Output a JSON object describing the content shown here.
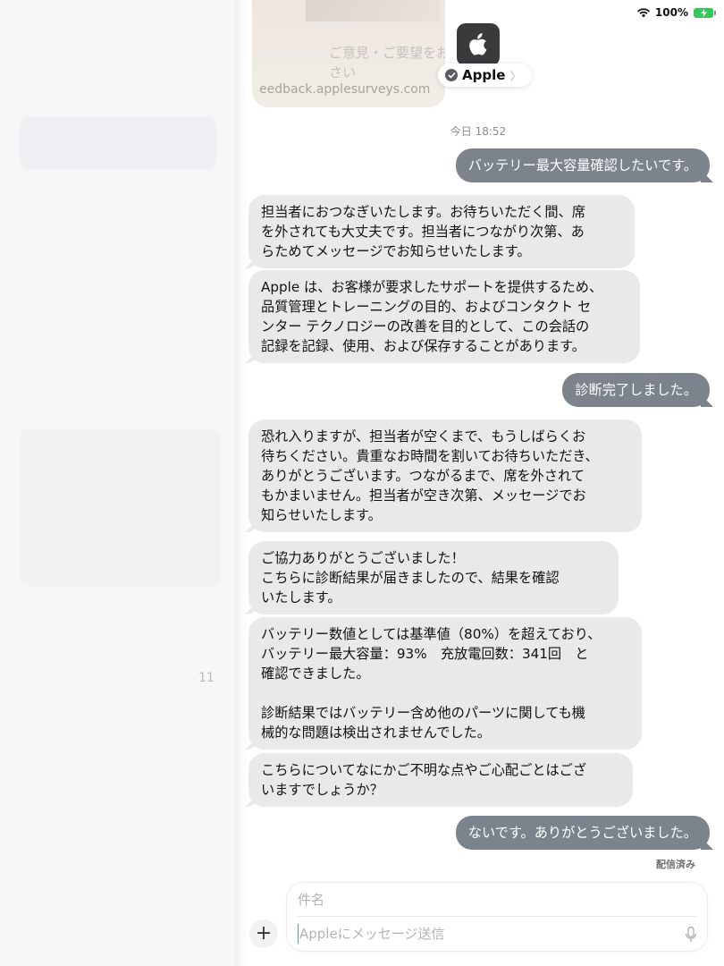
{
  "status_bar": {
    "battery_text": "100%"
  },
  "header": {
    "contact_name": "Apple",
    "preview": {
      "line1": "ご意見・ご要望をお",
      "line2": "さい",
      "url": "eedback.applesurveys.com"
    }
  },
  "sidebar": {
    "ghost_text_1": "11"
  },
  "thread": {
    "timestamp": "今日 18:52",
    "messages": [
      {
        "dir": "out",
        "text": "バッテリー最大容量確認したいです。"
      },
      {
        "dir": "in",
        "text": "担当者におつなぎいたします。お待ちいただく間、席\nを外されても大丈夫です。担当者につながり次第、あ\nらためてメッセージでお知らせいたします。"
      },
      {
        "dir": "in",
        "text": "Apple は、お客様が要求したサポートを提供するため、\n品質管理とトレーニングの目的、およびコンタクト セ\nンター テクノロジーの改善を目的として、この会話の\n記録を記録、使用、および保存することがあります。"
      },
      {
        "dir": "out",
        "text": "診断完了しました。"
      },
      {
        "dir": "in",
        "text": "恐れ入りますが、担当者が空くまで、もうしばらくお\n待ちください。貴重なお時間を割いてお待ちいただき、\nありがとうございます。つながるまで、席を外されて\nもかまいません。担当者が空き次第、メッセージでお\n知らせいたします。"
      },
      {
        "dir": "in",
        "text": "ご協力ありがとうございました！\nこちらに診断結果が届きましたので、結果を確認\nいたします。"
      },
      {
        "dir": "in",
        "text": "バッテリー数値としては基準値（80%）を超えており、\nバッテリー最大容量：93%　充放電回数：341回　と\n確認できました。\n\n診断結果ではバッテリー含め他のパーツに関しても機\n械的な問題は検出されませんでした。"
      },
      {
        "dir": "in",
        "text": "こちらについてなにかご不明な点やご心配ごとはござ\nいますでしょうか？"
      },
      {
        "dir": "out",
        "text": "ないです。ありがとうございました。"
      }
    ],
    "delivered_label": "配信済み"
  },
  "composer": {
    "subject_placeholder": "件名",
    "message_placeholder": "Appleにメッセージ送信",
    "plus_label": "+"
  },
  "icons": {
    "apple_logo": "apple-logo-icon",
    "verified": "verified-badge-icon",
    "wifi": "wifi-icon",
    "battery": "battery-charging-icon",
    "mic": "microphone-icon",
    "plus": "plus-icon"
  },
  "colors": {
    "outgoing_bubble": "#7c838d",
    "incoming_bubble": "#e9e9eb",
    "battery_green": "#35c759"
  }
}
